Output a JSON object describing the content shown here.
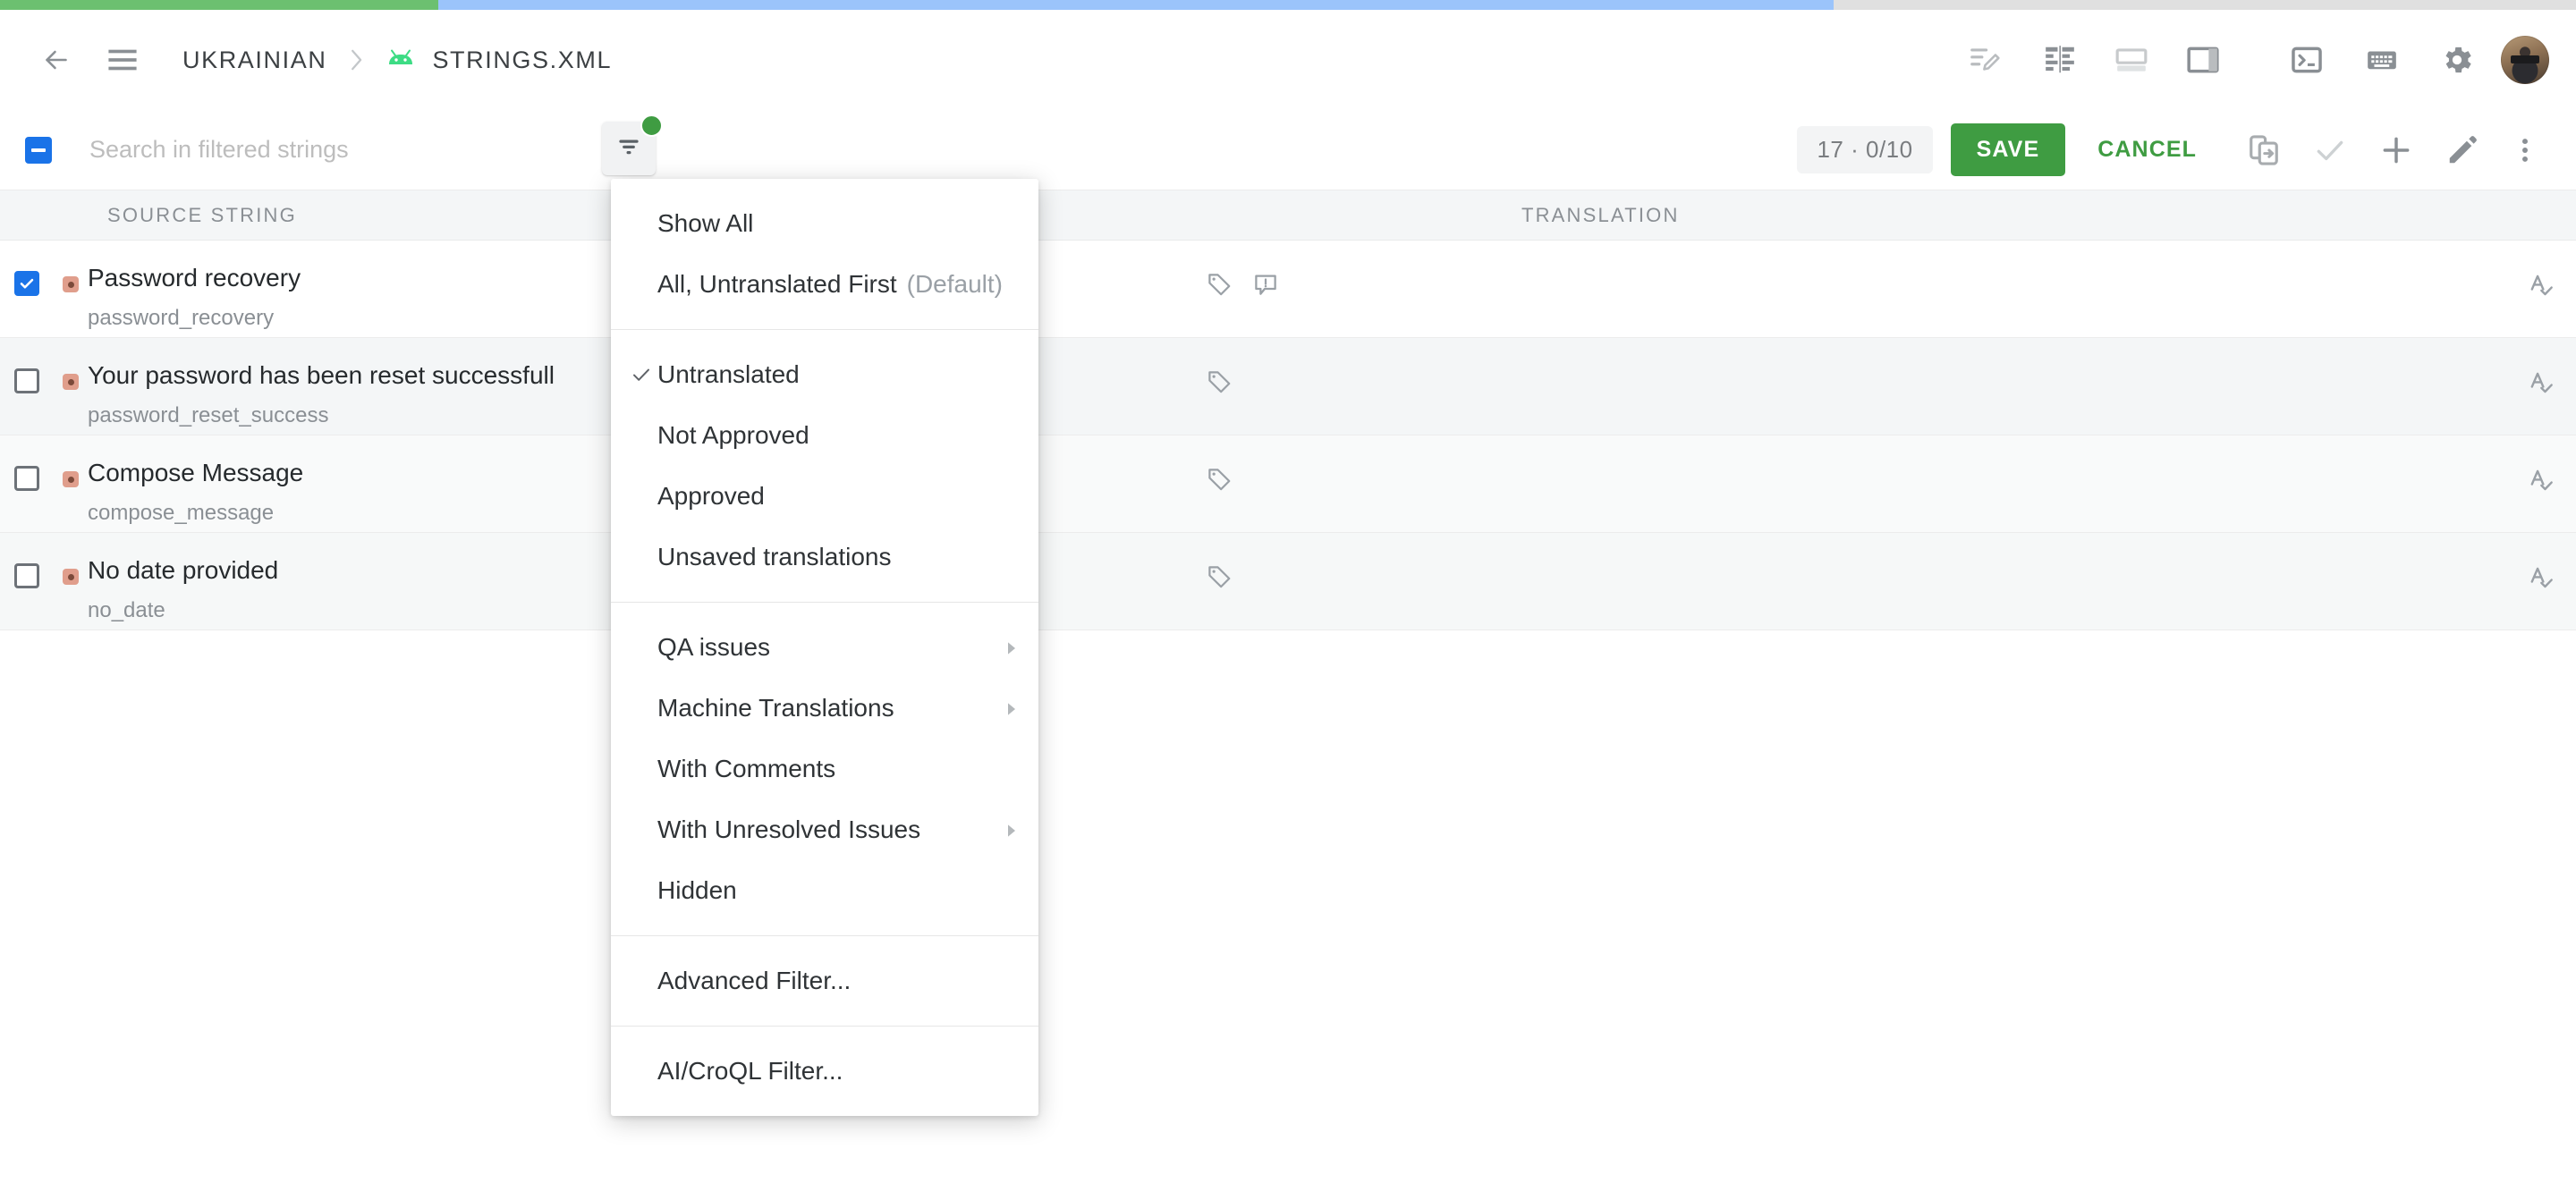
{
  "progress": {
    "green_pct": 17,
    "blue_pct": 71
  },
  "topbar": {
    "back_label": "Back",
    "menu_label": "Menu",
    "breadcrumb": {
      "project": "UKRAINIAN",
      "separator": "›",
      "file": "STRINGS.XML"
    },
    "icons": [
      {
        "name": "notes-edit-icon"
      },
      {
        "name": "split-columns-icon"
      },
      {
        "name": "layout-bottom-icon"
      },
      {
        "name": "layout-right-icon"
      },
      {
        "name": "terminal-icon"
      },
      {
        "name": "keyboard-icon"
      },
      {
        "name": "gear-icon"
      }
    ]
  },
  "actionbar": {
    "select_all_state": "indeterminate",
    "search": {
      "placeholder": "Search in filtered strings",
      "value": ""
    },
    "filter_button": {
      "name": "filter-icon",
      "badge_color": "#3f9c42",
      "active": true
    },
    "counter": "17 · 0/10",
    "save_label": "SAVE",
    "cancel_label": "CANCEL",
    "right_icons": [
      {
        "name": "copy-to-device-icon"
      },
      {
        "name": "approve-check-icon"
      },
      {
        "name": "add-icon"
      },
      {
        "name": "edit-pencil-icon"
      },
      {
        "name": "more-vertical-icon"
      }
    ]
  },
  "table": {
    "headers": {
      "source": "SOURCE STRING",
      "translation": "TRANSLATION"
    },
    "rows": [
      {
        "checked": true,
        "source": "Password recovery",
        "key": "password_recovery",
        "icons": [
          "tag-icon",
          "comment-alert-icon"
        ],
        "spellcheck": "spellcheck-icon"
      },
      {
        "checked": false,
        "source": "Your password has been reset successfull",
        "key": "password_reset_success",
        "icons": [
          "tag-icon"
        ],
        "spellcheck": "spellcheck-icon"
      },
      {
        "checked": false,
        "source": "Compose Message",
        "key": "compose_message",
        "icons": [
          "tag-icon"
        ],
        "spellcheck": "spellcheck-icon"
      },
      {
        "checked": false,
        "source": "No date provided",
        "key": "no_date",
        "icons": [
          "tag-icon"
        ],
        "spellcheck": "spellcheck-icon"
      }
    ]
  },
  "filter_menu": {
    "items": [
      {
        "label": "Show All",
        "checked": false,
        "submenu": false,
        "suffix": ""
      },
      {
        "label": "All, Untranslated First",
        "checked": false,
        "submenu": false,
        "suffix": "(Default)"
      },
      {
        "separator": true
      },
      {
        "label": "Untranslated",
        "checked": true,
        "submenu": false,
        "suffix": ""
      },
      {
        "label": "Not Approved",
        "checked": false,
        "submenu": false,
        "suffix": ""
      },
      {
        "label": "Approved",
        "checked": false,
        "submenu": false,
        "suffix": ""
      },
      {
        "label": "Unsaved translations",
        "checked": false,
        "submenu": false,
        "suffix": ""
      },
      {
        "separator": true
      },
      {
        "label": "QA issues",
        "checked": false,
        "submenu": true,
        "suffix": ""
      },
      {
        "label": "Machine Translations",
        "checked": false,
        "submenu": true,
        "suffix": ""
      },
      {
        "label": "With Comments",
        "checked": false,
        "submenu": false,
        "suffix": ""
      },
      {
        "label": "With Unresolved Issues",
        "checked": false,
        "submenu": true,
        "suffix": ""
      },
      {
        "label": "Hidden",
        "checked": false,
        "submenu": false,
        "suffix": ""
      },
      {
        "separator": true
      },
      {
        "label": "Advanced Filter...",
        "checked": false,
        "submenu": false,
        "suffix": ""
      },
      {
        "separator": true
      },
      {
        "label": "AI/CroQL Filter...",
        "checked": false,
        "submenu": false,
        "suffix": ""
      }
    ]
  },
  "colors": {
    "accent_green": "#3f9c42",
    "progress_green": "#6cc070",
    "progress_blue": "#9bc4fb",
    "checkbox_blue": "#1a73e8",
    "status_dot": "#e09e8c"
  }
}
